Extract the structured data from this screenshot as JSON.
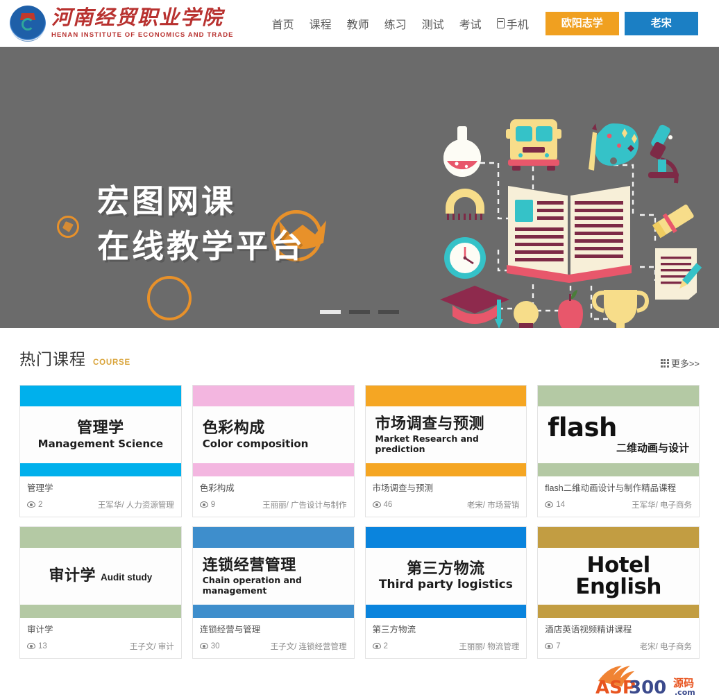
{
  "header": {
    "logo": {
      "icon": "school-seal-icon",
      "brand_cn": "河南经贸职业学院",
      "brand_en": "HENAN INSTITUTE OF ECONOMICS AND TRADE"
    },
    "nav": [
      {
        "label": "首页",
        "name": "nav-home"
      },
      {
        "label": "课程",
        "name": "nav-courses"
      },
      {
        "label": "教师",
        "name": "nav-teachers"
      },
      {
        "label": "练习",
        "name": "nav-practice"
      },
      {
        "label": "测试",
        "name": "nav-test"
      },
      {
        "label": "考试",
        "name": "nav-exam"
      }
    ],
    "phone_label": "手机",
    "phone_icon": "mobile-phone-icon",
    "user_button": "欧阳志学",
    "login_button": "老宋",
    "accent_orange": "#f0a020",
    "accent_blue": "#1b7fc4"
  },
  "banner": {
    "title_line1": "宏图网课",
    "title_line2": "在线教学平台",
    "background": "#6b6b6b",
    "ring_color": "#e8912a",
    "dots": [
      {
        "label": "1",
        "active": true
      },
      {
        "label": "2",
        "active": false
      },
      {
        "label": "3",
        "active": false
      }
    ],
    "illustration_items": [
      "flask-icon",
      "school-bus-icon",
      "paint-palette-icon",
      "microscope-icon",
      "protractor-icon",
      "alarm-clock-icon",
      "open-book-icon",
      "diploma-icon",
      "notepad-pencil-icon",
      "graduation-cap-icon",
      "lightbulb-icon",
      "apple-icon",
      "trophy-icon"
    ]
  },
  "section": {
    "title": "热门课程",
    "subtitle": "COURSE",
    "subtitle_color": "#d9a43a",
    "more_label": "更多>>",
    "more_icon": "grid-icon"
  },
  "courses": [
    {
      "cover_cn": "管理学",
      "cover_en": "Management Science",
      "align": "center",
      "style": "stack",
      "bar_color": "#00b0ec",
      "name": "管理学",
      "views": "2",
      "teacher": "王军华/ 人力资源管理"
    },
    {
      "cover_cn": "色彩构成",
      "cover_en": "Color composition",
      "align": "left",
      "style": "stack",
      "bar_color": "#f3b6e0",
      "name": "色彩构成",
      "views": "9",
      "teacher": "王丽丽/ 广告设计与制作"
    },
    {
      "cover_cn": "市场调查与预测",
      "cover_en": "Market Research and prediction",
      "align": "left",
      "style": "stack",
      "bar_color": "#f5a623",
      "name": "市场调查与预测",
      "views": "46",
      "teacher": "老宋/ 市场营销"
    },
    {
      "cover_cn": "flash",
      "cover_en": "二维动画与设计",
      "align": "right",
      "style": "bigword",
      "bar_color": "#b4c9a4",
      "name": "flash二维动画设计与制作精品课程",
      "views": "14",
      "teacher": "王军华/ 电子商务"
    },
    {
      "cover_cn": "审计学",
      "cover_en": "Audit study",
      "align": "center",
      "style": "inline",
      "bar_color": "#b4c9a4",
      "name": "审计学",
      "views": "13",
      "teacher": "王子文/ 审计"
    },
    {
      "cover_cn": "连锁经营管理",
      "cover_en": "Chain operation and management",
      "align": "left",
      "style": "stack",
      "bar_color": "#3e8ecc",
      "name": "连锁经营与管理",
      "views": "30",
      "teacher": "王子文/ 连锁经营管理"
    },
    {
      "cover_cn": "第三方物流",
      "cover_en": "Third party logistics",
      "align": "center",
      "style": "stack",
      "bar_color": "#0a84dd",
      "name": "第三方物流",
      "views": "2",
      "teacher": "王丽丽/ 物流管理"
    },
    {
      "cover_cn": "Hotel English",
      "cover_en": "",
      "align": "center",
      "style": "bigword-sm",
      "bar_color": "#c29d42",
      "name": "酒店英语视频精讲课程",
      "views": "7",
      "teacher": "老宋/ 电子商务"
    }
  ],
  "watermark": {
    "text_main": "ASP300",
    "text_cn": "源码",
    "text_tld": ".com"
  }
}
